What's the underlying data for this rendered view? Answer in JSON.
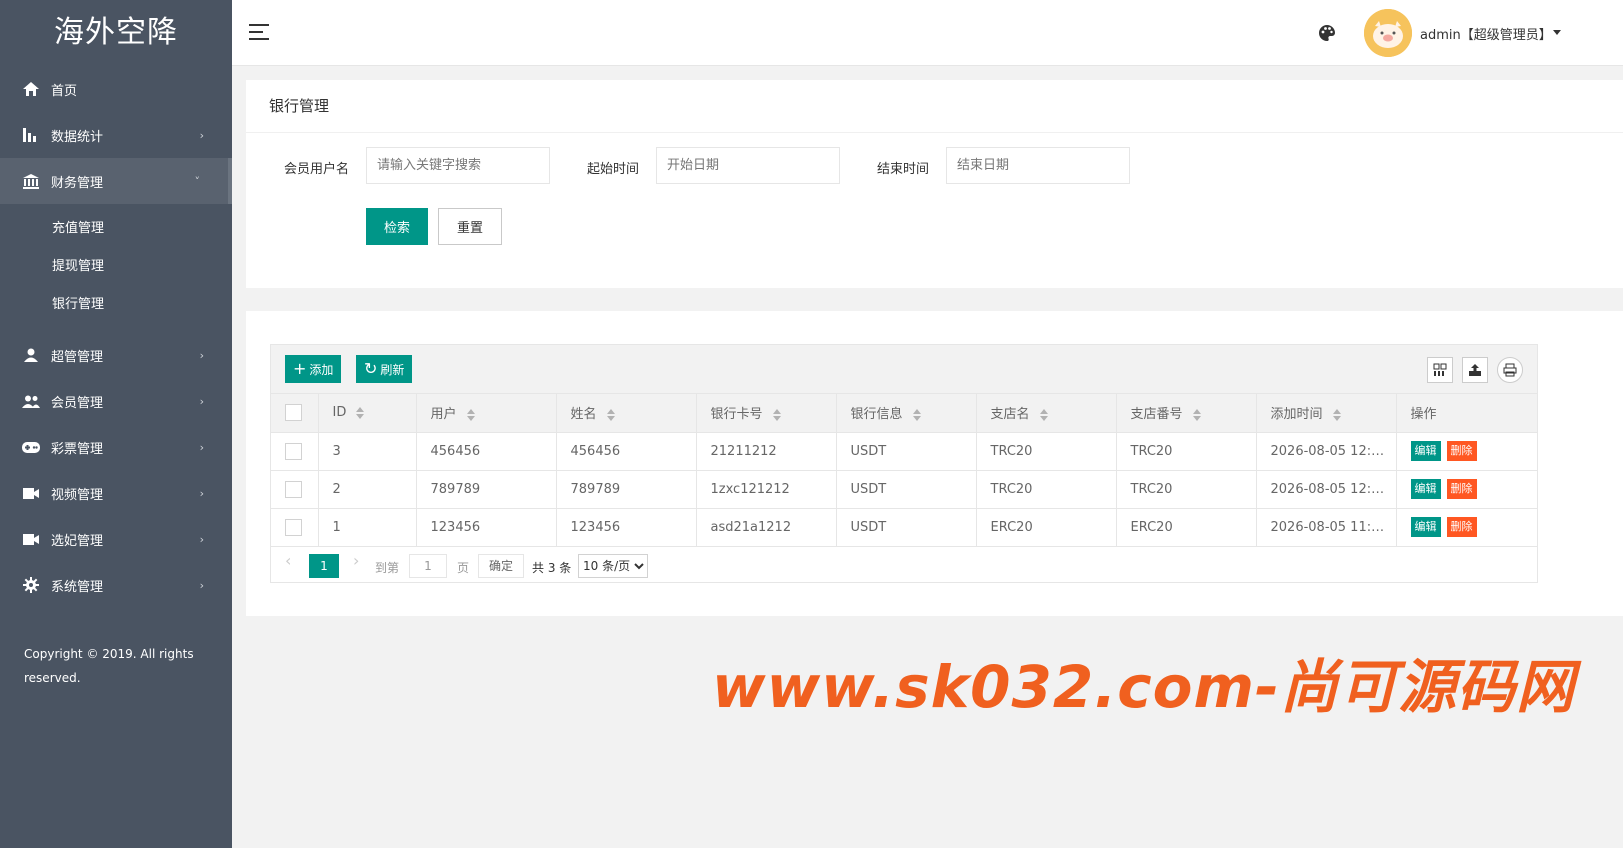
{
  "sidebar": {
    "logo": "海外空降",
    "items": [
      {
        "label": "首页",
        "icon": "home-icon"
      },
      {
        "label": "数据统计",
        "icon": "bar-chart-icon",
        "chevron": "›"
      },
      {
        "label": "财务管理",
        "icon": "bank-icon",
        "chevron": "˅"
      },
      {
        "label": "超管管理",
        "icon": "user-icon",
        "chevron": "›"
      },
      {
        "label": "会员管理",
        "icon": "group-icon",
        "chevron": "›"
      },
      {
        "label": "彩票管理",
        "icon": "gamepad-icon",
        "chevron": "›"
      },
      {
        "label": "视频管理",
        "icon": "video-icon",
        "chevron": "›"
      },
      {
        "label": "选妃管理",
        "icon": "video-icon",
        "chevron": "›"
      },
      {
        "label": "系统管理",
        "icon": "gear-icon",
        "chevron": "›"
      }
    ],
    "sub_items": [
      "充值管理",
      "提现管理",
      "银行管理"
    ],
    "copyright": "Copyright © 2019. All rights reserved."
  },
  "header": {
    "user_label": "admin【超级管理员】"
  },
  "search": {
    "title": "银行管理",
    "username_label": "会员用户名",
    "username_placeholder": "请输入关键字搜索",
    "start_label": "起始时间",
    "start_placeholder": "开始日期",
    "end_label": "结束时间",
    "end_placeholder": "结束日期",
    "search_btn": "检索",
    "reset_btn": "重置"
  },
  "toolbar": {
    "add_btn": "添加",
    "add_glyph": "+",
    "refresh_btn": "刷新",
    "refresh_glyph": "↻"
  },
  "table": {
    "columns": [
      "ID",
      "用户",
      "姓名",
      "银行卡号",
      "银行信息",
      "支店名",
      "支店番号",
      "添加时间",
      "操作"
    ],
    "rows": [
      {
        "id": "3",
        "user": "456456",
        "name": "456456",
        "card": "21211212",
        "bank": "USDT",
        "branch": "TRC20",
        "branch_no": "TRC20",
        "time": "2026-08-05 12:…"
      },
      {
        "id": "2",
        "user": "789789",
        "name": "789789",
        "card": "1zxc121212",
        "bank": "USDT",
        "branch": "TRC20",
        "branch_no": "TRC20",
        "time": "2026-08-05 12:…"
      },
      {
        "id": "1",
        "user": "123456",
        "name": "123456",
        "card": "asd21a1212",
        "bank": "USDT",
        "branch": "ERC20",
        "branch_no": "ERC20",
        "time": "2026-08-05 11:…"
      }
    ],
    "edit_label": "编辑",
    "delete_label": "删除"
  },
  "pager": {
    "prev": "‹",
    "current": "1",
    "next": "›",
    "goto_label": "到第",
    "goto_value": "1",
    "page_label": "页",
    "confirm_btn": "确定",
    "total": "共 3 条",
    "page_size": "10 条/页"
  },
  "watermark": "www.sk032.com-尚可源码网",
  "colors": {
    "accent": "#009688",
    "danger": "#ff5722",
    "sidebar": "#4a5462"
  }
}
